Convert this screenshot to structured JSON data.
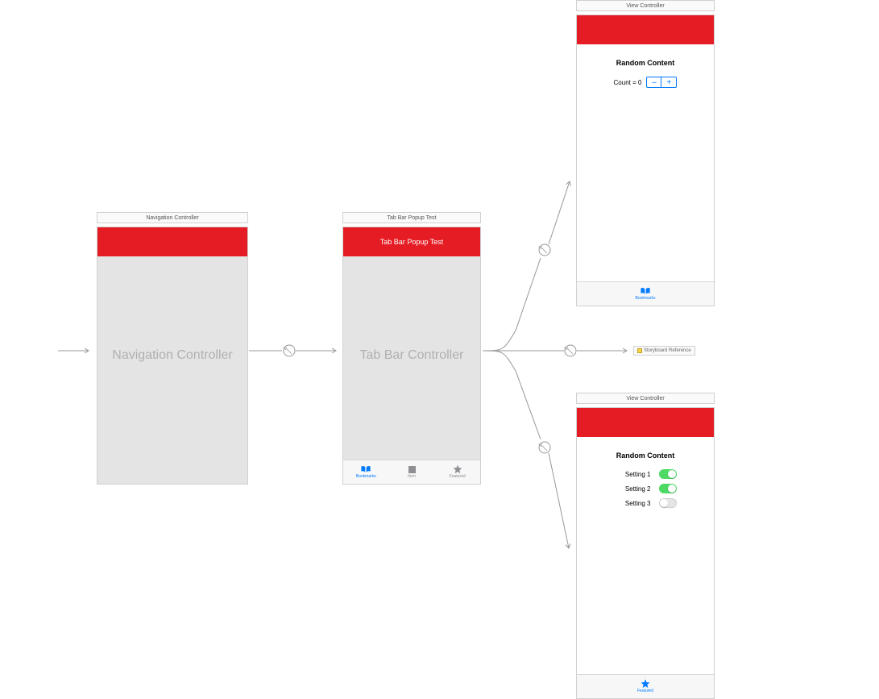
{
  "scenes": {
    "nav": {
      "title": "Navigation Controller",
      "placeholder": "Navigation Controller"
    },
    "tabbar": {
      "title": "Tab Bar Popup Test",
      "nav_title": "Tab Bar Popup Test",
      "placeholder": "Tab Bar Controller",
      "tabs": [
        {
          "label": "Bookmarks",
          "icon": "book",
          "active": true
        },
        {
          "label": "Item",
          "icon": "square",
          "active": false
        },
        {
          "label": "Featured",
          "icon": "star",
          "active": false
        }
      ]
    },
    "vc1": {
      "title": "View Controller",
      "heading": "Random Content",
      "count_label": "Count = 0",
      "stepper": {
        "minus": "–",
        "plus": "+"
      },
      "tab": {
        "label": "Bookmarks",
        "icon": "book"
      }
    },
    "vc2": {
      "title": "View Controller",
      "heading": "Random Content",
      "settings": [
        {
          "label": "Setting 1",
          "on": true
        },
        {
          "label": "Setting 2",
          "on": true
        },
        {
          "label": "Setting 3",
          "on": false
        }
      ],
      "tab": {
        "label": "Featured",
        "icon": "star"
      }
    },
    "sbref": {
      "label": "Storyboard Reference"
    }
  }
}
